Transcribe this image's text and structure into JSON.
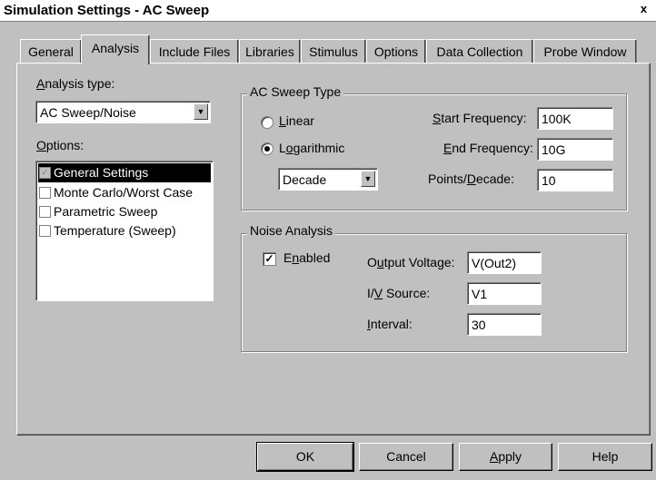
{
  "window": {
    "title": "Simulation Settings - AC Sweep",
    "close_glyph": "x"
  },
  "tabs": [
    "General",
    "Analysis",
    "Include Files",
    "Libraries",
    "Stimulus",
    "Options",
    "Data Collection",
    "Probe Window"
  ],
  "left": {
    "analysis_type_label": "Analysis type:",
    "analysis_type_value": "AC Sweep/Noise",
    "options_label": "Options:",
    "options": [
      {
        "label": "General Settings",
        "checked": true,
        "selected": true
      },
      {
        "label": "Monte Carlo/Worst Case",
        "checked": false,
        "selected": false
      },
      {
        "label": "Parametric Sweep",
        "checked": false,
        "selected": false
      },
      {
        "label": "Temperature (Sweep)",
        "checked": false,
        "selected": false
      }
    ]
  },
  "ac_sweep": {
    "group_label": "AC Sweep Type",
    "linear_label": "Linear",
    "log_label": "Logarithmic",
    "selected": "Logarithmic",
    "log_mode": "Decade",
    "start_label": "Start Frequency:",
    "start_value": "100K",
    "end_label": "End Frequency:",
    "end_value": "10G",
    "points_label": "Points/Decade:",
    "points_value": "10"
  },
  "noise": {
    "group_label": "Noise Analysis",
    "enabled_label": "Enabled",
    "enabled": true,
    "output_label": "Output Voltage:",
    "output_value": "V(Out2)",
    "source_label": "I/V Source:",
    "source_value": "V1",
    "interval_label": "Interval:",
    "interval_value": "30"
  },
  "buttons": {
    "ok": "OK",
    "cancel": "Cancel",
    "apply": "Apply",
    "help": "Help"
  },
  "colors": {
    "face": "#c0c0c0",
    "selection": "#000000",
    "window_bg": "#ffffff"
  }
}
